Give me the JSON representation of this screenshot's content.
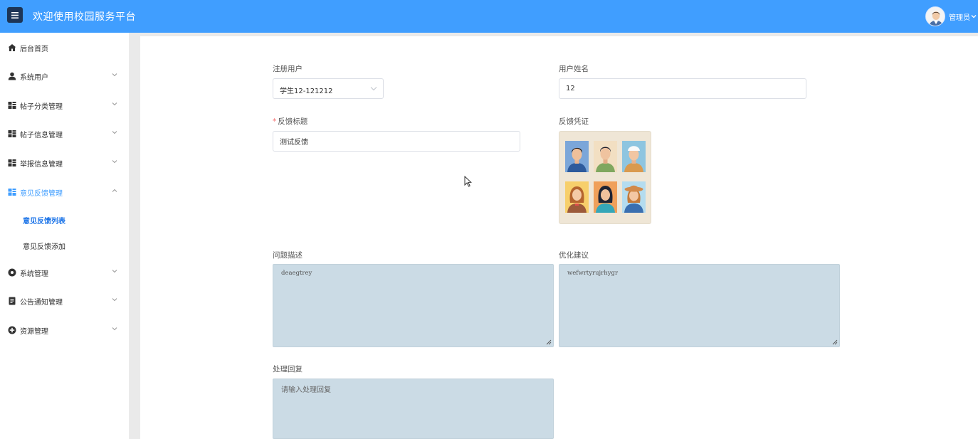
{
  "colors": {
    "brand": "#409eff",
    "accent": "#409eff",
    "textarea_bg": "#cbdbe5"
  },
  "header": {
    "menu_icon": "hamburger-icon",
    "title": "欢迎使用校园服务平台",
    "user": {
      "name": "管理员",
      "avatar": "user-avatar"
    }
  },
  "sidebar": {
    "items": [
      {
        "label": "后台首页",
        "icon": "home-icon"
      },
      {
        "label": "系统用户",
        "icon": "user-icon"
      },
      {
        "label": "帖子分类管理",
        "icon": "grid-icon"
      },
      {
        "label": "帖子信息管理",
        "icon": "grid-icon"
      },
      {
        "label": "举报信息管理",
        "icon": "grid-icon"
      },
      {
        "label": "意见反馈管理",
        "icon": "grid-icon"
      },
      {
        "label": "系统管理",
        "icon": "gear-icon"
      },
      {
        "label": "公告通知管理",
        "icon": "document-icon"
      },
      {
        "label": "资源管理",
        "icon": "plus-circle-icon"
      }
    ],
    "subitems": [
      {
        "label": "意见反馈列表"
      },
      {
        "label": "意见反馈添加"
      }
    ]
  },
  "form": {
    "registered_user": {
      "label": "注册用户",
      "value": "学生12-121212"
    },
    "user_name": {
      "label": "用户姓名",
      "value": "12"
    },
    "feedback_title": {
      "required_mark": "*",
      "label": "反馈标题",
      "value": "测试反馈"
    },
    "feedback_evidence": {
      "label": "反馈凭证"
    },
    "problem_description": {
      "label": "问题描述",
      "value": "deaegtrey"
    },
    "optimization_suggestion": {
      "label": "优化建议",
      "value": "wefwrtyrujrhygr"
    },
    "processing_reply": {
      "label": "处理回复",
      "placeholder": "请输入处理回复"
    }
  }
}
